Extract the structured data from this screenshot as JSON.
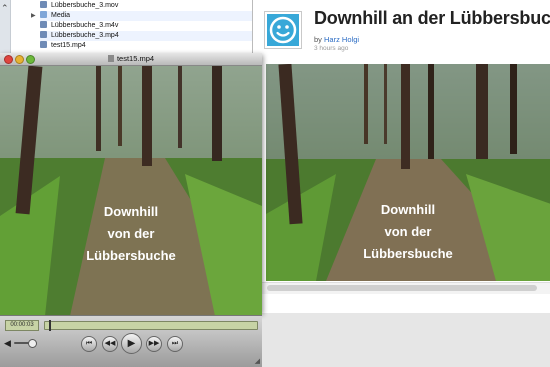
{
  "finder": {
    "rows": [
      {
        "label": "Lübbersbuche_3.mov",
        "expandable": false,
        "striped": false
      },
      {
        "label": "Media",
        "expandable": true,
        "striped": true
      },
      {
        "label": "Lübbersbuche_3.m4v",
        "expandable": false,
        "striped": false
      },
      {
        "label": "Lübbersbuche_3.mp4",
        "expandable": false,
        "striped": true
      },
      {
        "label": "test15.mp4",
        "expandable": false,
        "striped": false
      }
    ]
  },
  "web": {
    "title": "Downhill an der Lübbersbuche",
    "by_prefix": "by ",
    "author": "Harz Holgi",
    "time_ago": "3 hours ago"
  },
  "player": {
    "window_title": "test15.mp4",
    "time": "00:00:03",
    "position_fraction": 0.02,
    "volume_fraction": 0.8
  },
  "video": {
    "caption_lines": [
      "Downhill",
      "von der",
      "Lübbersbuche"
    ]
  },
  "colors": {
    "avatar": "#38a8d8",
    "link": "#2b6cc4",
    "player_lcd": "#c7d3a5"
  },
  "icons": {
    "close": "close-icon",
    "minimize": "minimize-icon",
    "zoom": "zoom-icon",
    "volume": "volume-icon",
    "previous": "previous-icon",
    "rewind": "rewind-icon",
    "play": "play-icon",
    "fast_forward": "fast-forward-icon",
    "next": "next-icon",
    "avatar": "smiley-avatar-icon"
  }
}
